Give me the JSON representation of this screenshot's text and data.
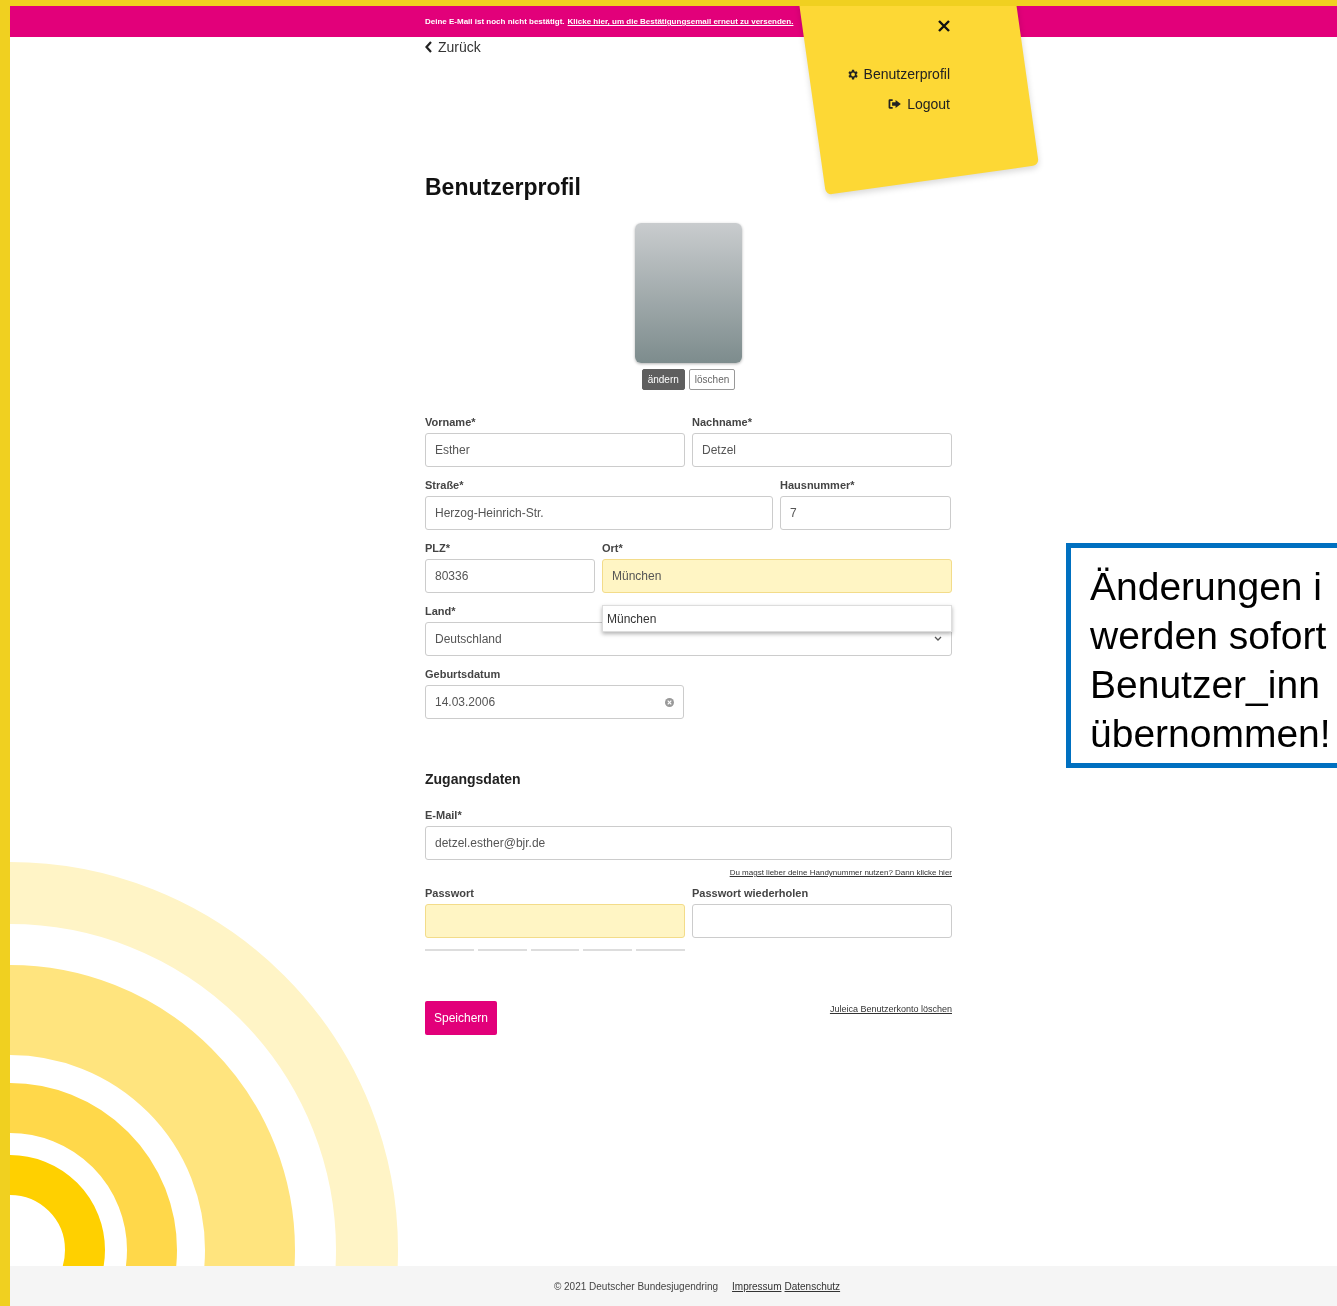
{
  "banner": {
    "text": "Deine E-Mail ist noch nicht bestätigt.",
    "link": "Klicke hier, um die Bestätigungsemail erneut zu versenden."
  },
  "back_link": "Zurück",
  "menu": {
    "items": [
      {
        "label": "Benutzerprofil",
        "kind": "gear"
      },
      {
        "label": "Logout",
        "kind": "logout"
      }
    ]
  },
  "title": "Benutzerprofil",
  "photo_buttons": [
    {
      "label": "ändern",
      "kind": "filled"
    },
    {
      "label": "löschen",
      "kind": "outline"
    }
  ],
  "rows": [
    [
      {
        "label": "Vorname*",
        "value": "Esther",
        "kind": "text",
        "highlighted": false
      },
      {
        "label": "Nachname*",
        "value": "Detzel",
        "kind": "text",
        "highlighted": false
      }
    ],
    [
      {
        "label": "Straße*",
        "value": "Herzog-Heinrich-Str.",
        "kind": "text",
        "highlighted": false
      },
      {
        "label": "Hausnummer*",
        "value": "7",
        "kind": "text",
        "highlighted": false
      }
    ],
    [
      {
        "label": "PLZ*",
        "value": "80336",
        "kind": "text",
        "highlighted": false
      },
      {
        "label": "Ort*",
        "value": "München",
        "kind": "text",
        "highlighted": true,
        "suggestion": "München"
      }
    ],
    [
      {
        "label": "Land*",
        "value": "Deutschland",
        "kind": "select",
        "highlighted": false
      }
    ],
    [
      {
        "label": "Geburtsdatum",
        "value": "14.03.2006",
        "kind": "date",
        "highlighted": false
      }
    ]
  ],
  "access": {
    "heading": "Zugangsdaten",
    "email_label": "E-Mail*",
    "email": "detzel.esther@bjr.de",
    "phone_link": "Du magst lieber deine Handynummer nutzen? Dann klicke hier",
    "password_label": "Passwort",
    "password_highlighted": true,
    "repeat_label": "Passwort wiederholen"
  },
  "save_button": "Speichern",
  "delete_link": "Juleica Benutzerkonto löschen",
  "footer": {
    "copyright": "© 2021 Deutscher Bundesjugendring",
    "links": [
      "Impressum",
      "Datenschutz"
    ]
  },
  "callout": [
    "Änderungen i",
    "werden sofort",
    "Benutzer_inn",
    "übernommen!"
  ]
}
